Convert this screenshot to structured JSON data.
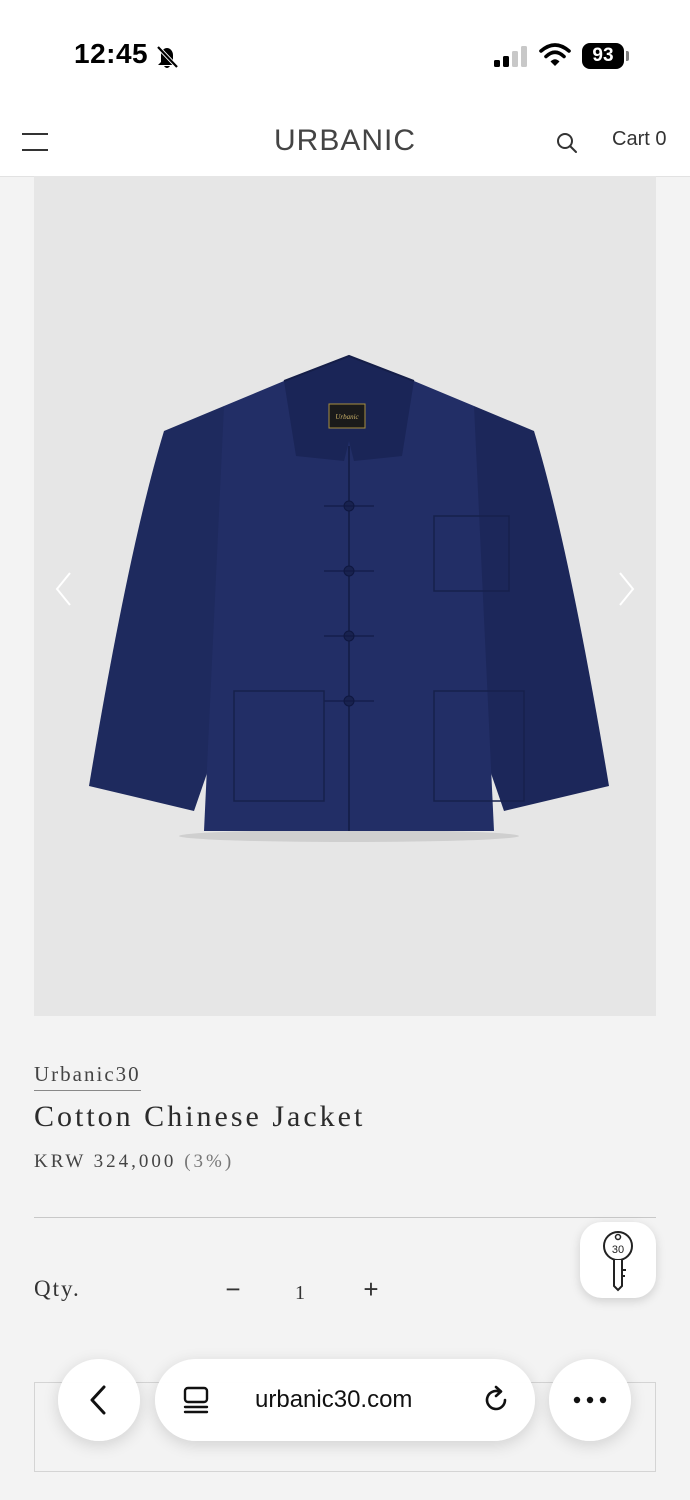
{
  "status_bar": {
    "time": "12:45",
    "battery": "93"
  },
  "header": {
    "logo": "URBANIC",
    "cart": "Cart 0"
  },
  "product": {
    "brand": "Urbanic30",
    "title": "Cotton Chinese Jacket",
    "price": "KRW 324,000",
    "price_note": "(3%)",
    "image_color": "#1e2a5e",
    "label_text": "Urbanic"
  },
  "quantity": {
    "label": "Qty.",
    "minus": "−",
    "value": "1",
    "plus": "+"
  },
  "floating_widget": {
    "text": "30"
  },
  "browser": {
    "url": "urbanic30.com"
  },
  "icons": [
    "bell-slash-icon",
    "signal-icon",
    "wifi-icon",
    "battery-icon",
    "menu-icon",
    "search-icon",
    "chevron-left-icon",
    "chevron-right-icon",
    "key-icon",
    "back-icon",
    "tabs-icon",
    "reload-icon",
    "more-icon"
  ]
}
